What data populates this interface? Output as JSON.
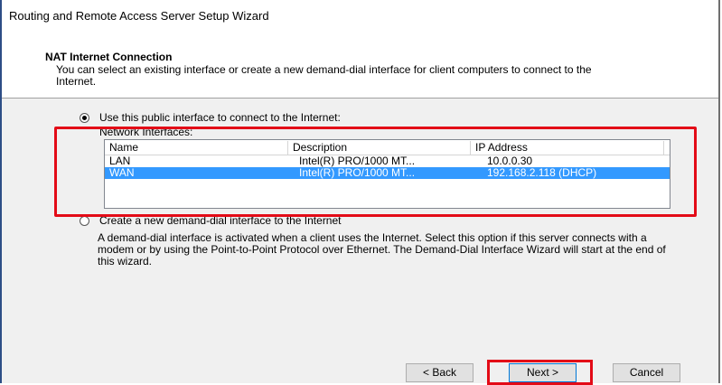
{
  "window": {
    "title": "Routing and Remote Access Server Setup Wizard"
  },
  "header": {
    "title": "NAT Internet Connection",
    "subtitle": "You can select an existing interface or create a new demand-dial interface for client computers to connect to the Internet."
  },
  "options": {
    "public_interface_label": "Use this public interface to connect to the Internet:",
    "network_interfaces_label": "Network Interfaces:",
    "demand_dial_label": "Create a new demand-dial interface to the Internet",
    "demand_dial_description": "A demand-dial interface is activated when a client uses the Internet. Select this option if this server connects with a modem or by using the Point-to-Point Protocol over Ethernet. The Demand-Dial Interface Wizard will start at the end of this wizard."
  },
  "table": {
    "columns": [
      "Name",
      "Description",
      "IP Address"
    ],
    "rows": [
      {
        "name": "LAN",
        "description": "Intel(R) PRO/1000 MT...",
        "ip": "10.0.0.30",
        "selected": false
      },
      {
        "name": "WAN",
        "description": "Intel(R) PRO/1000 MT...",
        "ip": "192.168.2.118 (DHCP)",
        "selected": true
      }
    ]
  },
  "buttons": {
    "back": "< Back",
    "next": "Next >",
    "cancel": "Cancel"
  },
  "colors": {
    "highlight": "#e30b17",
    "selection": "#3399ff"
  }
}
